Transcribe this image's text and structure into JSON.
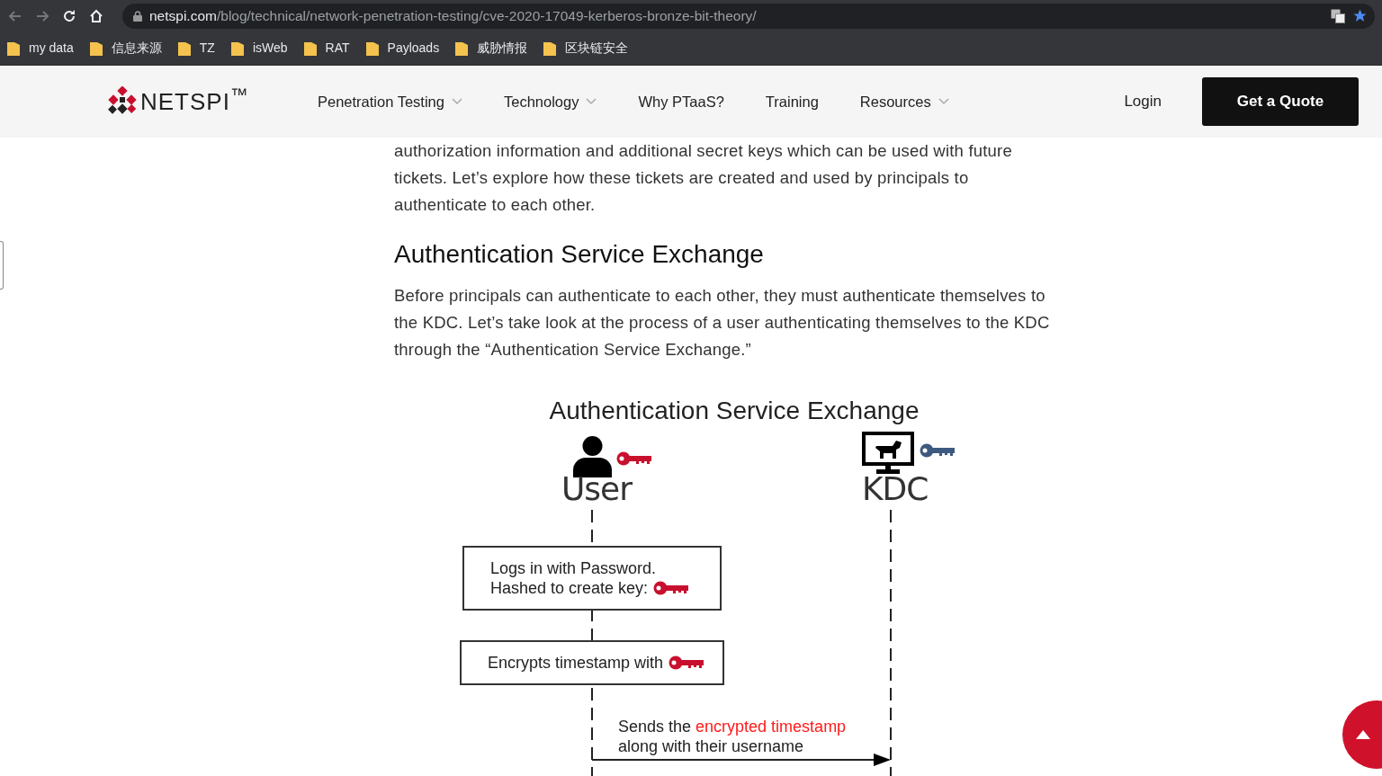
{
  "browser": {
    "url": {
      "domain": "netspi.com",
      "path": "/blog/technical/network-penetration-testing/cve-2020-17049-kerberos-bronze-bit-theory/"
    },
    "bookmarked": true,
    "bookmarks": [
      "my data",
      "信息来源",
      "TZ",
      "isWeb",
      "RAT",
      "Payloads",
      "威胁情报",
      "区块链安全"
    ]
  },
  "header": {
    "logo": "NETSPI$^{™}$",
    "nav": [
      {
        "label": "Penetration Testing",
        "dropdown": true
      },
      {
        "label": "Technology",
        "dropdown": true
      },
      {
        "label": "Why PTaaS?",
        "dropdown": false
      },
      {
        "label": "Training",
        "dropdown": false
      },
      {
        "label": "Resources",
        "dropdown": true
      }
    ],
    "login": "Login",
    "cta": "Get a Quote"
  },
  "article": {
    "paragraph_1": "authorization information and additional secret keys which can be used with future tickets. Let’s explore how these tickets are created and used by principals to authenticate to each other.",
    "heading": "Authentication Service Exchange",
    "paragraph_2": "Before principals can authenticate to each other, they must authenticate themselves to the KDC. Let’s take look at the process of a user authenticating themselves to the KDC through the “Authentication Service Exchange.”",
    "figure": {
      "title": "Authentication Service Exchange",
      "actors": [
        {
          "kind": "user",
          "label": "User"
        },
        {
          "kind": "kdc",
          "label": "KDC"
        }
      ],
      "steps": [
        {
          "lines": [
            "Logs in with Password.",
            "Hashed to create key:"
          ]
        },
        {
          "lines": [
            "Encrypts timestamp with"
          ]
        }
      ],
      "message": [
        {
          "parts": [
            {
              "text": "Sends the ",
              "highlight": false
            },
            {
              "text": "encrypted timestamp",
              "highlight": true
            }
          ]
        },
        {
          "parts": [
            {
              "text": "along with their username",
              "highlight": false
            }
          ]
        }
      ]
    }
  }
}
